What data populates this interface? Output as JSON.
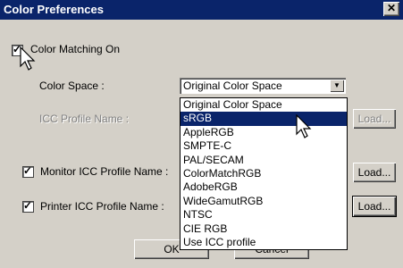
{
  "dialog": {
    "title": "Color Preferences",
    "close_glyph": "✕"
  },
  "color_matching": {
    "label": "Color Matching On",
    "checked": true
  },
  "color_space": {
    "label": "Color Space :",
    "selected": "Original Color Space",
    "options": [
      "Original Color Space",
      "sRGB",
      "AppleRGB",
      "SMPTE-C",
      "PAL/SECAM",
      "ColorMatchRGB",
      "AdobeRGB",
      "WideGamutRGB",
      "NTSC",
      "CIE RGB",
      "Use ICC profile"
    ],
    "highlighted": "sRGB"
  },
  "icc_profile": {
    "label": "ICC Profile Name :",
    "load_label": "Load..."
  },
  "monitor": {
    "label": "Monitor ICC Profile Name :",
    "checked": true,
    "load_label": "Load..."
  },
  "printer": {
    "label": "Printer ICC Profile Name :",
    "checked": true,
    "load_label": "Load..."
  },
  "footer": {
    "ok_label": "OK",
    "cancel_label": "Cancel"
  },
  "colors": {
    "titlebar": "#0a246a",
    "face": "#d4d0c8",
    "highlight": "#0a246a"
  }
}
